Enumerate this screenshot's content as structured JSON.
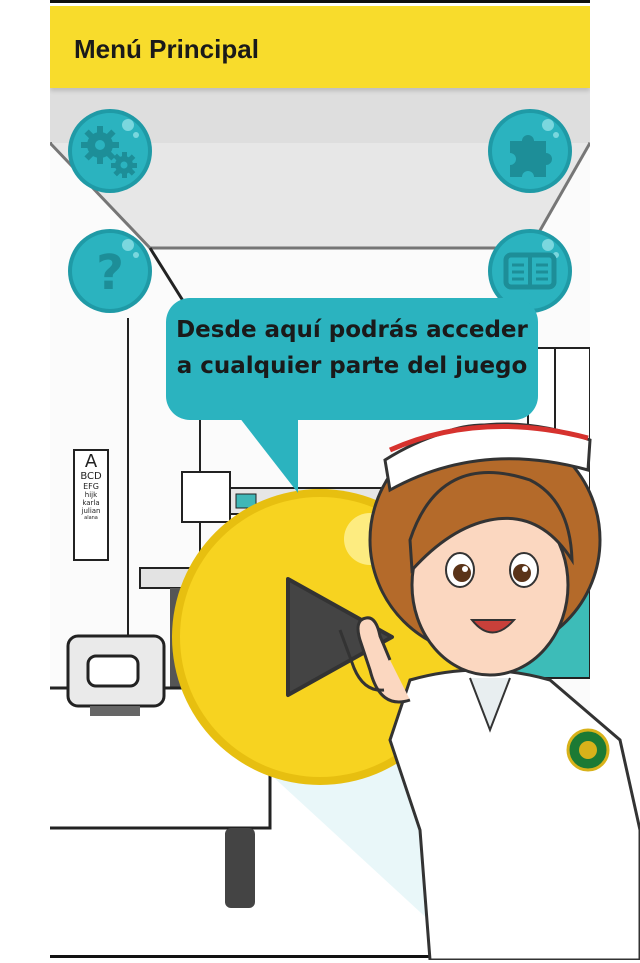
{
  "header": {
    "title": "Menú Principal"
  },
  "menu": {
    "settings_icon": "gears-icon",
    "puzzle_icon": "puzzle-icon",
    "help_icon": "question-icon",
    "book_icon": "open-book-icon"
  },
  "bubble": {
    "text": "Desde aquí podrás acceder a cualquier parte del juego"
  },
  "eye_chart": {
    "lines": [
      "A",
      "BCD",
      "EFG",
      "hijk",
      "karla",
      "julian",
      "alana"
    ]
  },
  "colors": {
    "header": "#f8dc2c",
    "teal": "#2bb3bf",
    "play_yellow": "#f7d320",
    "play_arrow": "#444444"
  }
}
